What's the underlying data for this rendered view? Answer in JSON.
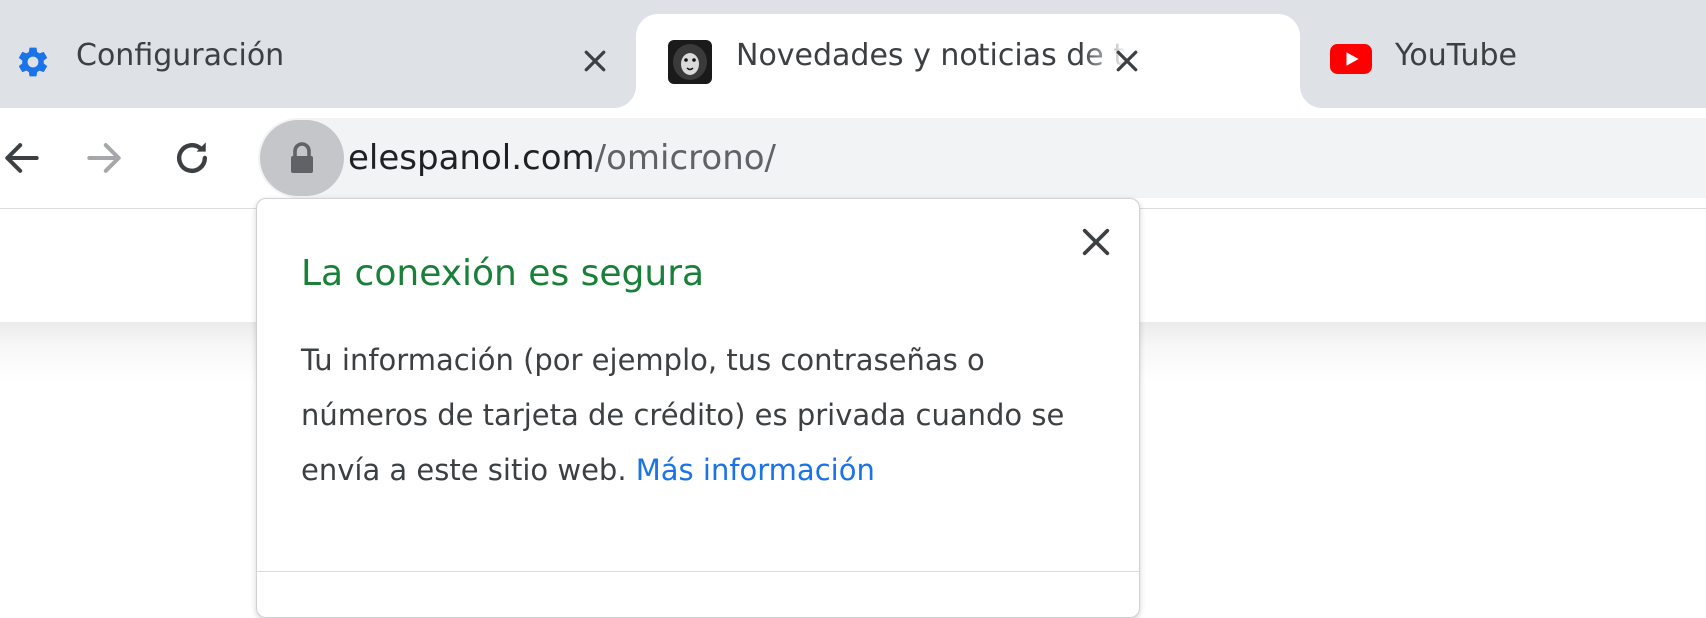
{
  "tabs": [
    {
      "title": "Configuración",
      "icon": "gear-icon",
      "active": false
    },
    {
      "title": "Novedades y noticias de tecnología",
      "icon": "lion-favicon-icon",
      "active": true
    },
    {
      "title": "YouTube",
      "icon": "youtube-icon",
      "active": false
    }
  ],
  "omnibox": {
    "domain": "elespanol.com",
    "path": "/omicrono/",
    "lock_icon": "lock-icon"
  },
  "security_popup": {
    "title": "La conexión es segura",
    "body": "Tu información (por ejemplo, tus contraseñas o números de tarjeta de crédito) es privada cuando se envía a este sitio web.",
    "link": "Más información"
  },
  "colors": {
    "tabstrip": "#dee1e6",
    "secure_green": "#188038",
    "link_blue": "#1a73e8",
    "gear_blue": "#1a73e8",
    "youtube_red": "#ff0000"
  }
}
